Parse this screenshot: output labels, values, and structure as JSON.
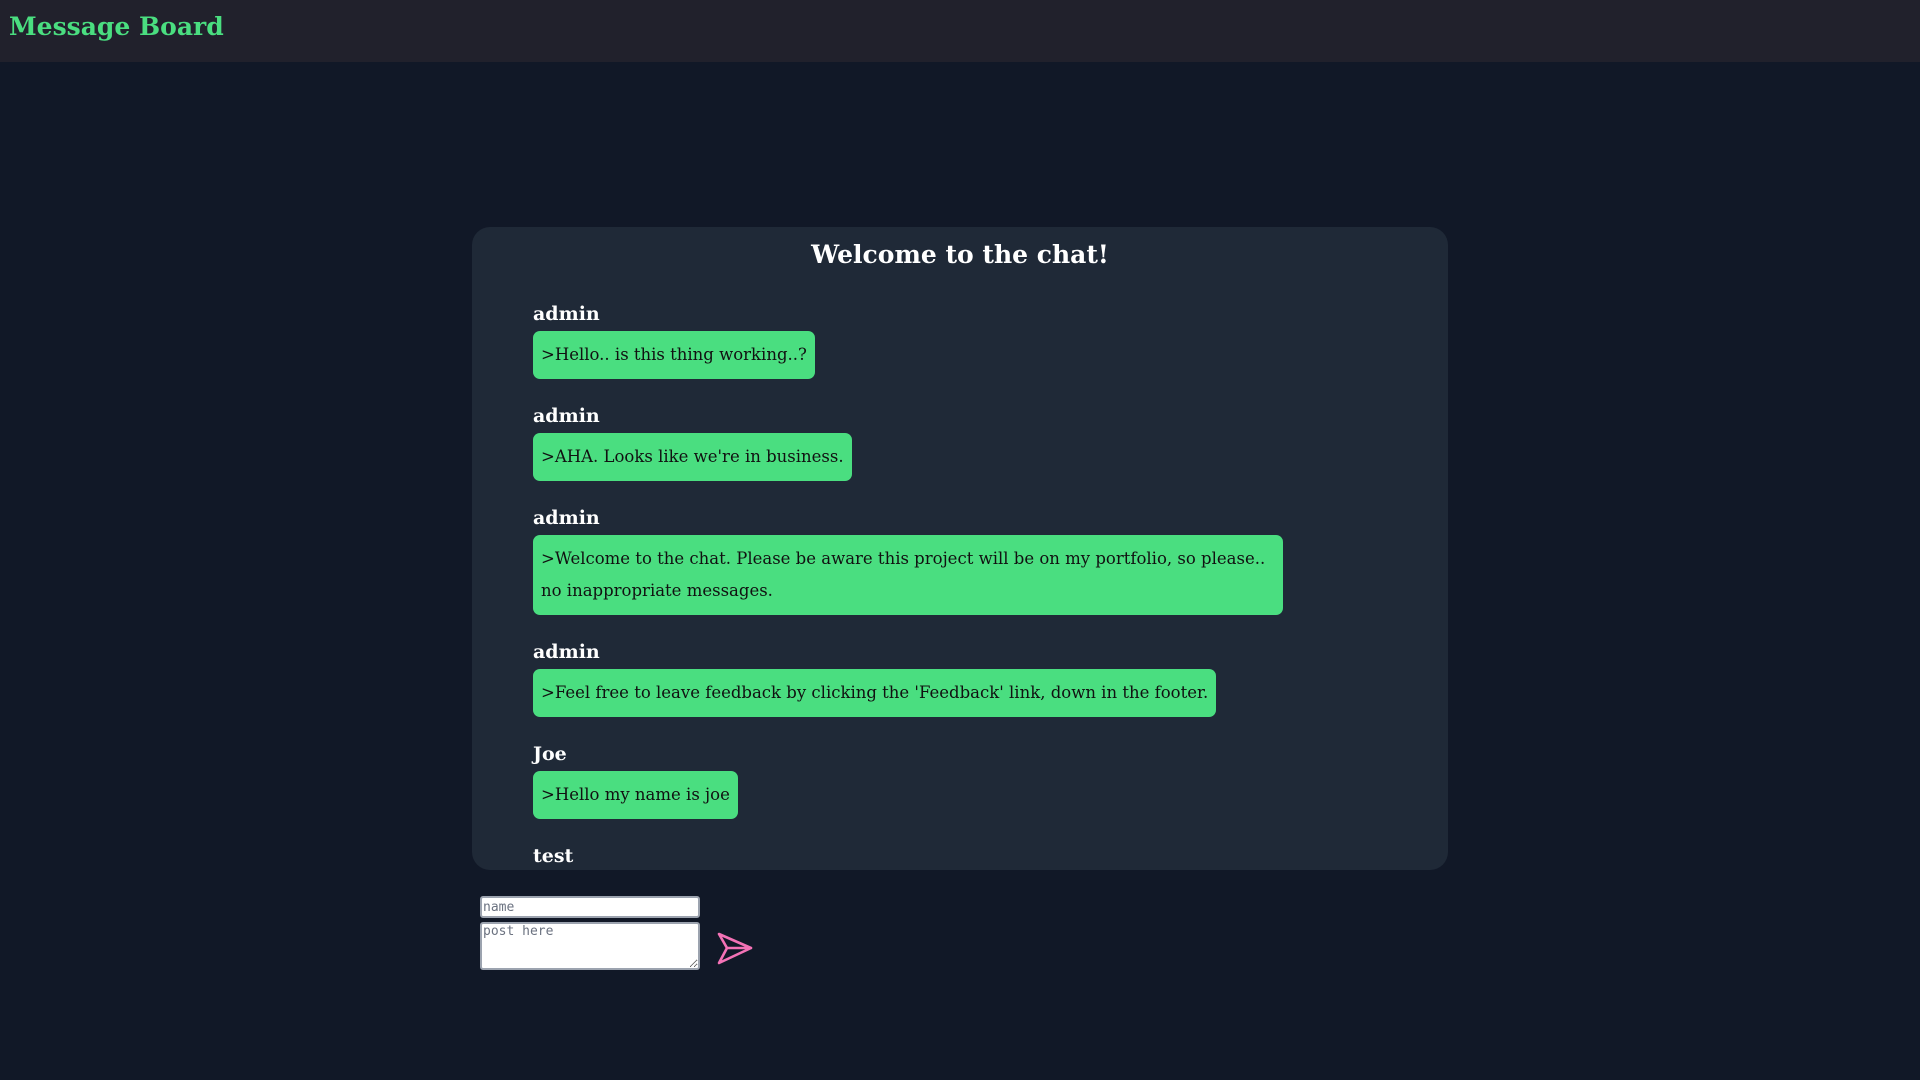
{
  "header": {
    "brand": "Message Board"
  },
  "chat": {
    "title": "Welcome to the chat!",
    "messages": [
      {
        "author": "admin",
        "text": ">Hello.. is this thing working..?"
      },
      {
        "author": "admin",
        "text": ">AHA. Looks like we're in business."
      },
      {
        "author": "admin",
        "text": ">Welcome to the chat. Please be aware this project will be on my portfolio, so please.. no inappropriate messages."
      },
      {
        "author": "admin",
        "text": ">Feel free to leave feedback by clicking the 'Feedback' link, down in the footer."
      },
      {
        "author": "Joe",
        "text": ">Hello my name is joe"
      },
      {
        "author": "test",
        "text": ""
      }
    ]
  },
  "form": {
    "name_placeholder": "name",
    "post_placeholder": "post here",
    "send_icon": "paper-plane-icon"
  },
  "colors": {
    "background": "#111827",
    "header": "#21212c",
    "panel": "#1f2937",
    "accent_green": "#4ade80",
    "send_pink": "#f472b6"
  }
}
